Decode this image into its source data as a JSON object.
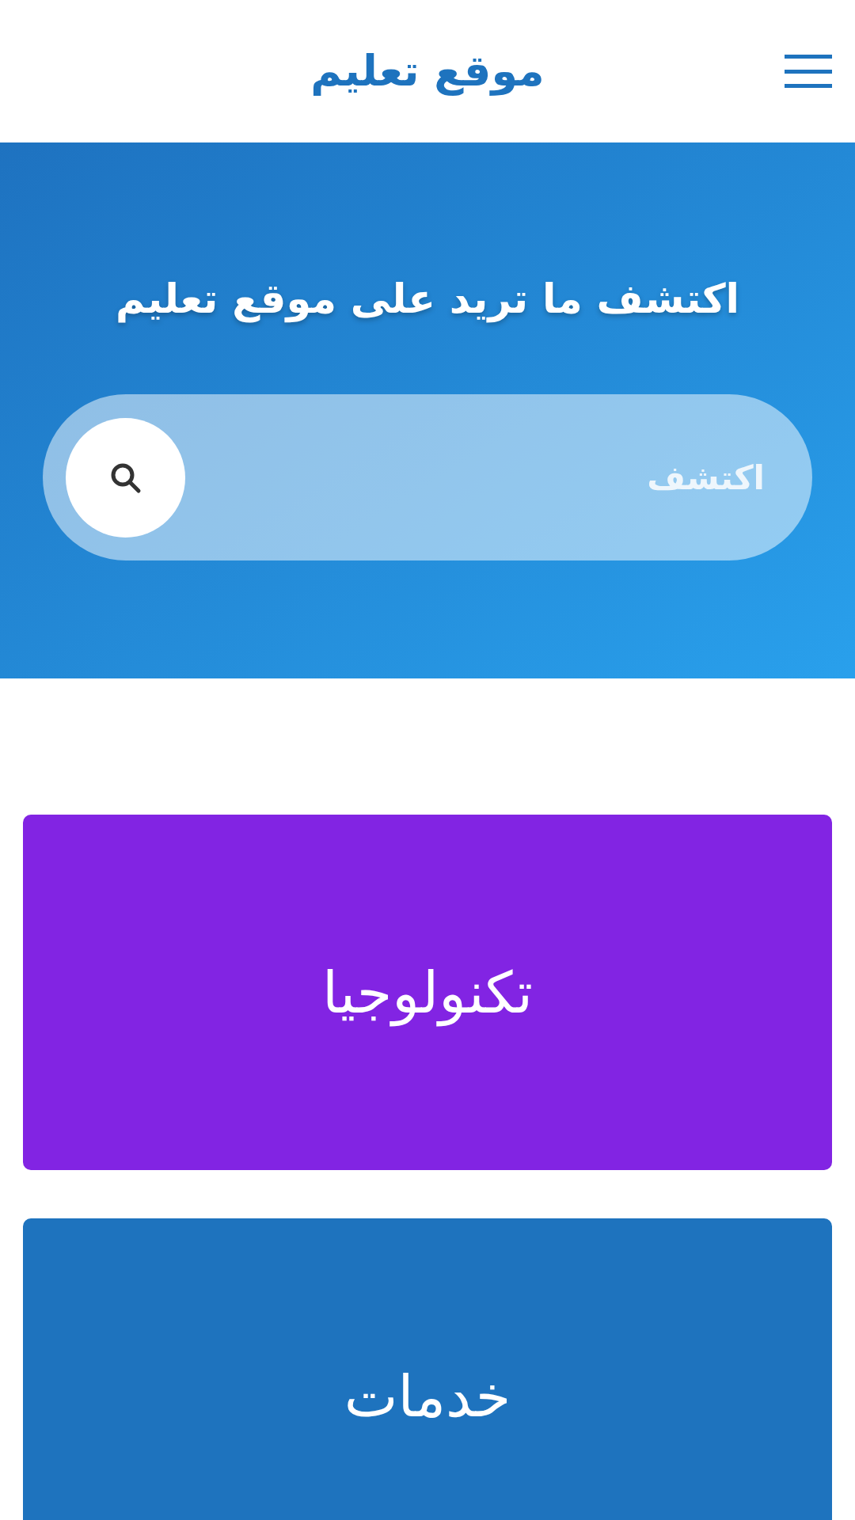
{
  "header": {
    "title": "موقع تعليم"
  },
  "hero": {
    "heading": "اكتشف ما تريد على موقع تعليم",
    "search": {
      "placeholder": "اكتشف"
    }
  },
  "categories": [
    {
      "label": "تكنولوجيا",
      "color": "#8224e3"
    },
    {
      "label": "خدمات",
      "color": "#1e73be"
    }
  ]
}
